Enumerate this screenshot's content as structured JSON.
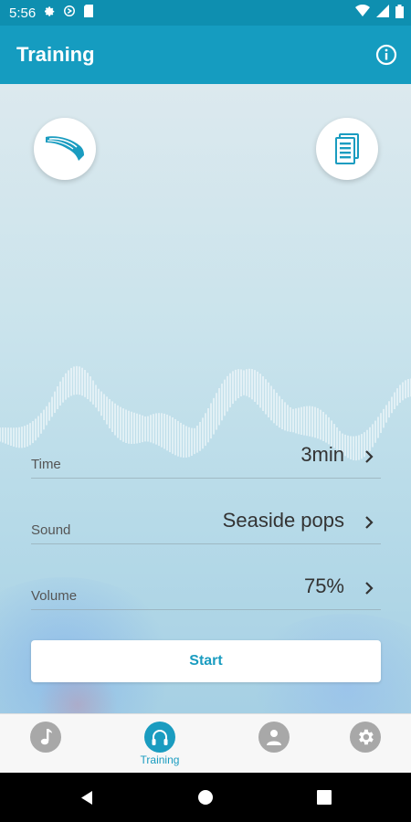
{
  "status_bar": {
    "time": "5:56"
  },
  "app_bar": {
    "title": "Training"
  },
  "settings": [
    {
      "label": "Time",
      "value": "3min"
    },
    {
      "label": "Sound",
      "value": "Seaside pops"
    },
    {
      "label": "Volume",
      "value": "75%"
    }
  ],
  "start_label": "Start",
  "bottom_nav": {
    "items": [
      {
        "icon": "music-note-icon",
        "label": ""
      },
      {
        "icon": "headphones-icon",
        "label": "Training",
        "active": true
      },
      {
        "icon": "person-icon",
        "label": ""
      },
      {
        "icon": "gear-icon",
        "label": ""
      }
    ]
  },
  "colors": {
    "accent": "#1A9CC0",
    "app_bar": "#159CC0",
    "status_bar": "#0E8FB0",
    "nav_inactive": "#A8A8A8"
  }
}
